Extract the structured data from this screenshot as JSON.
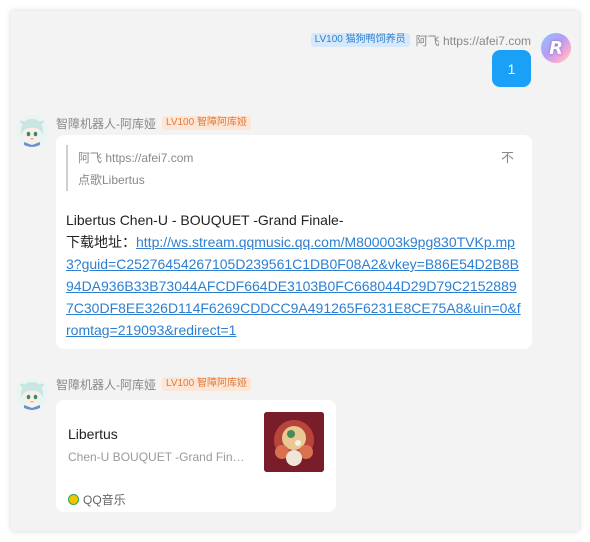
{
  "message1": {
    "badge": "LV100 猫狗鸭饲养员",
    "sender": "阿飞 https://afei7.com",
    "avatar_letter": "R",
    "text": "1"
  },
  "message2": {
    "sender": "智障机器人-阿库娅",
    "badge": "LV100 智障阿库娅",
    "quote": {
      "author": "阿飞 https://afei7.com",
      "text": "点歌Libertus",
      "icon": "不"
    },
    "song_line": "Libertus Chen-U - BOUQUET -Grand Finale-",
    "download_label": "下载地址：",
    "download_link": "http://ws.stream.qqmusic.qq.com/M800003k9pg830TVKp.mp3?guid=C25276454267105D239561C1DB0F08A2&vkey=B86E54D2B8B94DA936B33B73044AFCDF664DE3103B0FC668044D29D79C21528897C30DF8EE326D114F6269CDDCC9A491265F6231E8CE75A8&uin=0&fromtag=219093&redirect=1"
  },
  "message3": {
    "sender": "智障机器人-阿库娅",
    "badge": "LV100 智障阿库娅",
    "music": {
      "title": "Libertus",
      "subtitle": "Chen-U BOUQUET -Grand Finale-",
      "source": "QQ音乐"
    }
  },
  "colors": {
    "bubble_blue": "#1aa0f7",
    "link_blue": "#2e7fd0",
    "badge_blue_bg": "#d5e9fb",
    "badge_orange_bg": "#fde6d6"
  }
}
